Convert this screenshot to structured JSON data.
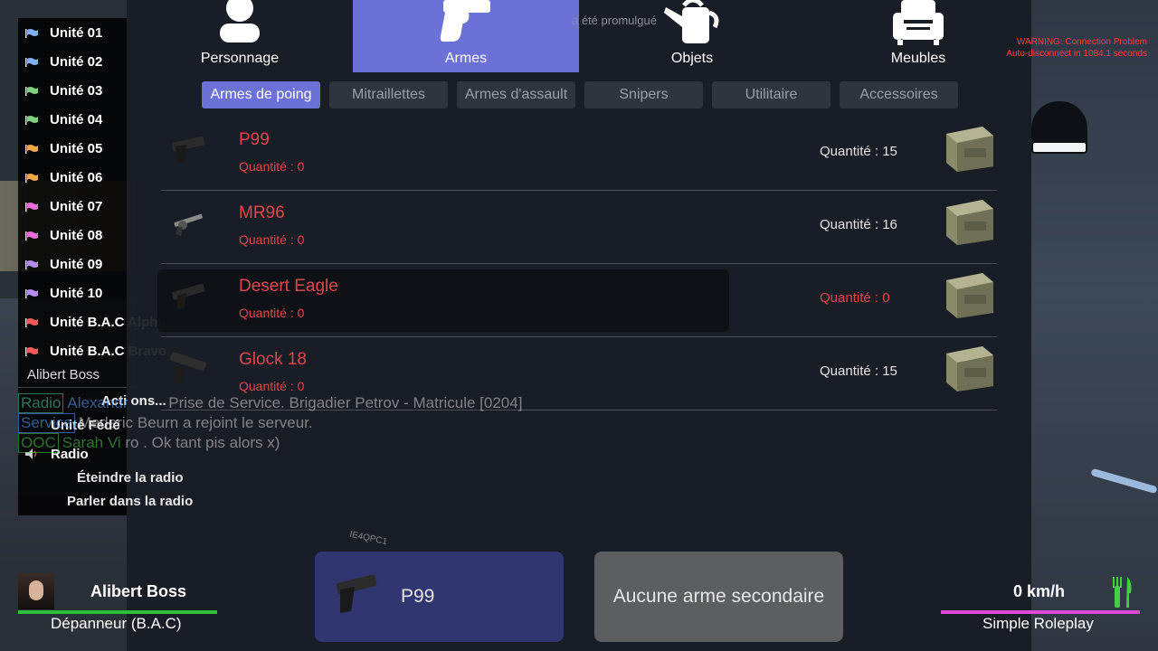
{
  "top_notice": "a été promulgué",
  "warning": {
    "line1": "WARNING:  Connection Problem",
    "line2": "Auto-disconnect in 1084.1 seconds"
  },
  "categories": [
    {
      "label": "Personnage",
      "icon": "person-icon"
    },
    {
      "label": "Armes",
      "icon": "pistol-icon"
    },
    {
      "label": "Objets",
      "icon": "watering-can-icon"
    },
    {
      "label": "Meubles",
      "icon": "armchair-icon"
    }
  ],
  "active_category": "Armes",
  "subtabs": [
    "Armes de poing",
    "Mitraillettes",
    "Armes d'assault",
    "Snipers",
    "Utilitaire",
    "Accessoires"
  ],
  "active_subtab": "Armes de poing",
  "weapons": [
    {
      "name": "P99",
      "owned": "Quantité : 0",
      "stock": "Quantité : 15"
    },
    {
      "name": "MR96",
      "owned": "Quantité : 0",
      "stock": "Quantité : 16"
    },
    {
      "name": "Desert Eagle",
      "owned": "Quantité : 0",
      "stock": "Quantité : 0"
    },
    {
      "name": "Glock 18",
      "owned": "Quantité : 0",
      "stock": "Quantité : 15"
    }
  ],
  "equipped": {
    "primary": "P99",
    "secondary": "Aucune arme secondaire"
  },
  "floor_tag": "IE4QPC1",
  "units": [
    {
      "label": "Unité 01",
      "flag": "#7fb2f0"
    },
    {
      "label": "Unité 02",
      "flag": "#7fb2f0"
    },
    {
      "label": "Unité 03",
      "flag": "#7fd07f"
    },
    {
      "label": "Unité 04",
      "flag": "#7fd07f"
    },
    {
      "label": "Unité 05",
      "flag": "#f0a84a"
    },
    {
      "label": "Unité 06",
      "flag": "#f0a84a"
    },
    {
      "label": "Unité 07",
      "flag": "#e86bd8"
    },
    {
      "label": "Unité 08",
      "flag": "#e86bd8"
    },
    {
      "label": "Unité 09",
      "flag": "#b48cf0"
    },
    {
      "label": "Unité 10",
      "flag": "#b48cf0"
    },
    {
      "label": "Unité B.A.C Alpha",
      "flag": "#f05a5a"
    },
    {
      "label": "Unité B.A.C Bravo",
      "flag": "#f05a5a"
    }
  ],
  "owner_name": "Alibert Boss",
  "menu_actions": "Acti ons...",
  "radio": {
    "unit_federal": "Unité Fédé",
    "label": "Radio",
    "off": "Éteindre la radio",
    "talk": "Parler dans la radio"
  },
  "chat": [
    {
      "tag": "Radio",
      "tag_color": "#4ec9a6",
      "name": "Alexandr",
      "text": "Prise de Service. Brigadier Petrov - Matricule [0204]"
    },
    {
      "tag": "Service",
      "tag_color": "#5aa0ff",
      "name": "Mederic",
      "text": "Beurn a rejoint le serveur."
    },
    {
      "tag": "OOC",
      "tag_color": "#4ec94e",
      "name": "Sarah Vi",
      "text": "ro . Ok tant pis alors x)"
    }
  ],
  "hud": {
    "player_name": "Alibert Boss",
    "job": "Dépanneur (B.A.C)",
    "speed": "0 km/h",
    "server": "Simple Roleplay"
  }
}
